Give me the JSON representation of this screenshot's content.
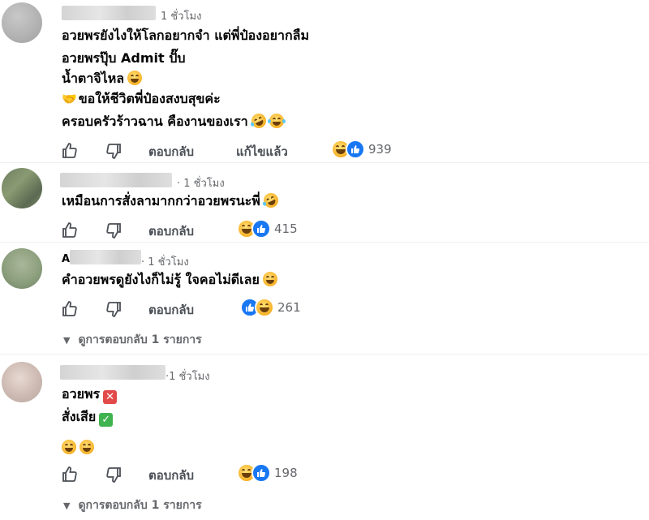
{
  "comments": [
    {
      "time": "1 ชั่วโมง",
      "lines": [
        "อวยพรยังไงให้โลกอยากจำ แต่พี่ป๋องอยากลืม",
        "อวยพรปุ๊บ Admit ปั๊บ",
        "น้ำตาจิไหล",
        "ขอให้ชีวิตพี่ป๋องสงบสุขค่ะ",
        "ครอบครัวร้าวฉาน คืองานของเรา"
      ],
      "reply_label": "ตอบกลับ",
      "edited_label": "แก้ไขแล้ว",
      "reaction_count": "939",
      "reactions": [
        "haha",
        "like"
      ]
    },
    {
      "time": "· 1 ชั่วโมง",
      "lines": [
        "เหมือนการสั่งลามากกว่าอวยพรนะพี่"
      ],
      "reply_label": "ตอบกลับ",
      "reaction_count": "415",
      "reactions": [
        "haha",
        "like"
      ]
    },
    {
      "name_initial": "A",
      "time": "· 1 ชั่วโมง",
      "lines": [
        "คำอวยพรดูยังไงก็ไม่รู้ ใจคอไม่ดีเลย"
      ],
      "reply_label": "ตอบกลับ",
      "reaction_count": "261",
      "reactions": [
        "like",
        "haha"
      ],
      "view_replies": "ดูการตอบกลับ 1 รายการ"
    },
    {
      "time": "·1 ชั่วโมง",
      "lines": [
        "อวยพร",
        "สั่งเสีย"
      ],
      "reply_label": "ตอบกลับ",
      "reaction_count": "198",
      "reactions": [
        "haha",
        "like"
      ],
      "view_replies": "ดูการตอบกลับ 1 รายการ"
    }
  ],
  "icons": {
    "like_action": "thumbs-up-outline-icon",
    "dislike_action": "thumbs-down-outline-icon",
    "chevron": "chevron-down-icon"
  },
  "colors": {
    "like_blue": "#1877f2",
    "meta_gray": "#65676b",
    "text": "#050505"
  }
}
